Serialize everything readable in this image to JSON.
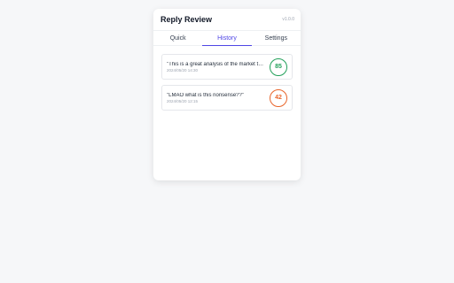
{
  "app": {
    "title": "Reply Review",
    "version": "v1.0.0"
  },
  "tabs": [
    {
      "label": "Quick",
      "active": false
    },
    {
      "label": "History",
      "active": true
    },
    {
      "label": "Settings",
      "active": false
    }
  ],
  "history": [
    {
      "text": "\"This is a great analysis of the market trends\"",
      "time": "2024/05/20 14:30",
      "score": "85",
      "color": "#22a05a"
    },
    {
      "text": "\"LMAO what is this nonsense??\"",
      "time": "2024/05/20 12:15",
      "score": "42",
      "color": "#e8652b"
    }
  ],
  "colors": {
    "accent": "#4f46e5",
    "high_score": "#22a05a",
    "low_score": "#e8652b"
  }
}
